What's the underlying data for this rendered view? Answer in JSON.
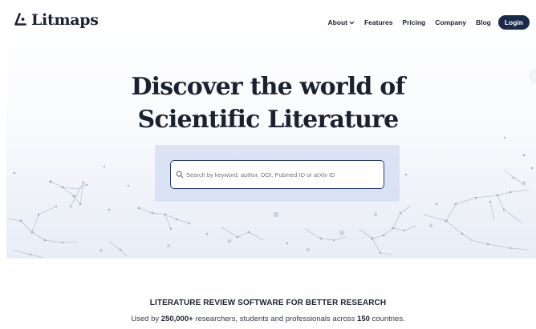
{
  "brand": {
    "name": "Litmaps",
    "logo_icon": "litmaps-logo-icon"
  },
  "nav": {
    "about": "About",
    "features": "Features",
    "pricing": "Pricing",
    "company": "Company",
    "blog": "Blog",
    "login": "Login"
  },
  "hero": {
    "title_line1": "Discover the world of",
    "title_line2": "Scientific Literature"
  },
  "search": {
    "placeholder": "Search by keyword, author, DOI, Pubmed ID or arXiv ID",
    "value": ""
  },
  "section": {
    "tagline": "LITERATURE REVIEW SOFTWARE FOR BETTER RESEARCH",
    "stats_prefix": "Used by ",
    "stats_users": "250,000+",
    "stats_middle": " researchers, students and professionals across ",
    "stats_countries": "150",
    "stats_suffix": " countries."
  },
  "colors": {
    "brand_navy": "#1b2a4a",
    "search_panel": "#d1dcf2",
    "network_nodes": "#aab3c2"
  }
}
